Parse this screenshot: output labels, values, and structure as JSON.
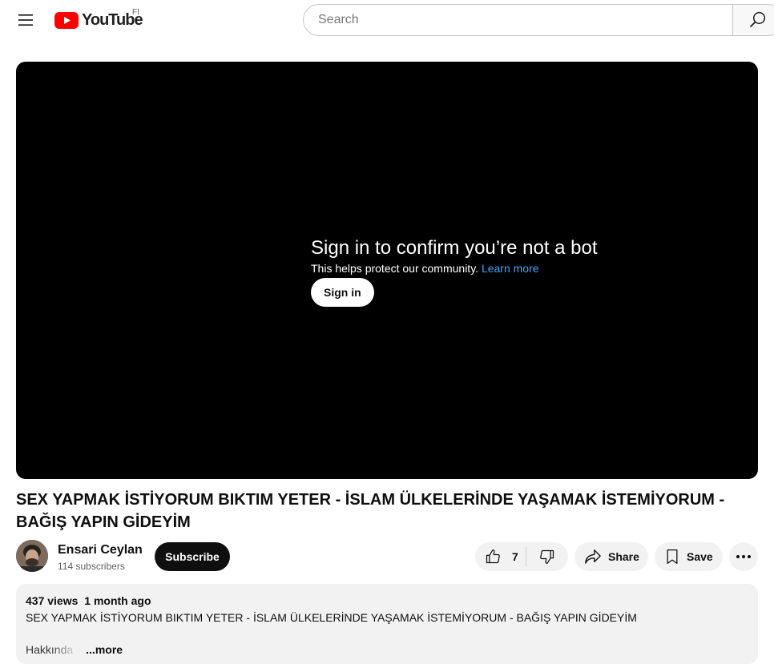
{
  "masthead": {
    "logo_text": "YouTube",
    "country_code": "FI",
    "search_placeholder": "Search"
  },
  "player": {
    "overlay_title": "Sign in to confirm you’re not a bot",
    "overlay_subtitle": "This helps protect our community.",
    "learn_more": "Learn more",
    "signin_label": "Sign in"
  },
  "video": {
    "title": "SEX YAPMAK İSTİYORUM BIKTIM YETER - İSLAM ÜLKELERİNDE YAŞAMAK İSTEMİYORUM - BAĞIŞ YAPIN GİDEYİM"
  },
  "owner": {
    "channel_name": "Ensari Ceylan",
    "subscribers": "114 subscribers",
    "subscribe_label": "Subscribe"
  },
  "actions": {
    "like_count": "7",
    "share_label": "Share",
    "save_label": "Save"
  },
  "description": {
    "views": "437 views",
    "date": "1 month ago",
    "text": "SEX YAPMAK İSTİYORUM BIKTIM YETER - İSLAM ÜLKELERİNDE YAŞAMAK İSTEMİYORUM - BAĞIŞ YAPIN GİDEYİM",
    "preview": "Hakkında",
    "more_label": "...more"
  },
  "colors": {
    "brand_red": "#ff0000",
    "link_blue": "#3ea6ff",
    "pill_bg": "#f2f2f2"
  }
}
